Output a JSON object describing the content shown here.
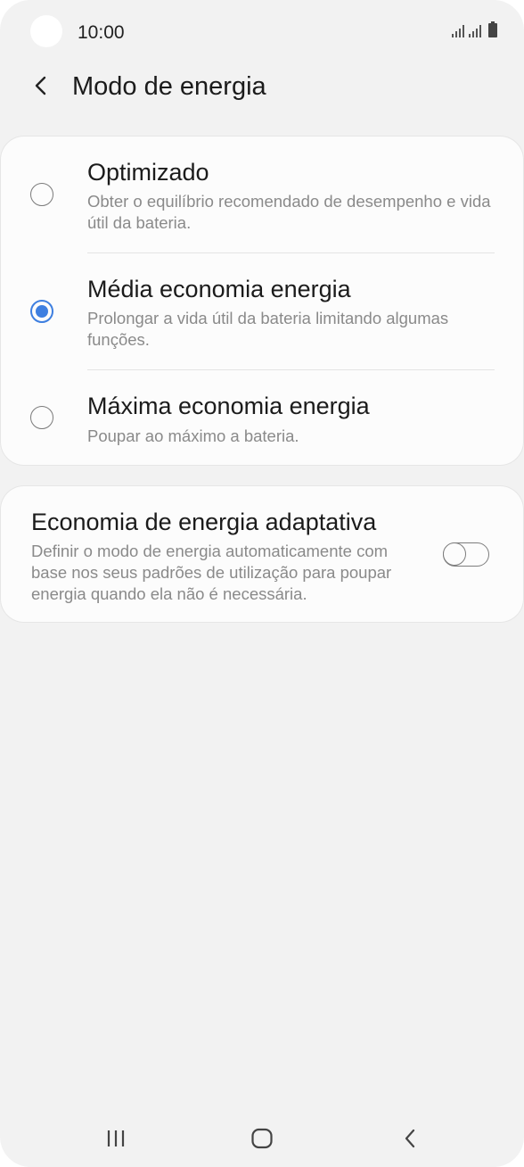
{
  "status_bar": {
    "time": "10:00",
    "icons": [
      "signal-icon",
      "signal-icon",
      "battery-icon"
    ]
  },
  "header": {
    "back_icon": "chevron-left-icon",
    "title": "Modo de energia"
  },
  "power_modes": {
    "selected_index": 1,
    "options": [
      {
        "title": "Optimizado",
        "description": "Obter o equilíbrio recomendado de desempenho e vida útil da bateria.",
        "selected": false
      },
      {
        "title": "Média economia energia",
        "description": "Prolongar a vida útil da bateria limitando algumas funções.",
        "selected": true
      },
      {
        "title": "Máxima economia energia",
        "description": "Poupar ao máximo a bateria.",
        "selected": false
      }
    ]
  },
  "adaptive": {
    "title": "Economia de energia adaptativa",
    "description": "Definir o modo de energia automaticamente com base nos seus padrões de utilização para poupar energia quando ela não é necessária.",
    "enabled": false
  },
  "nav_bar": {
    "recents_icon": "recents-icon",
    "home_icon": "home-icon",
    "back_icon": "back-icon"
  },
  "colors": {
    "accent": "#3e7fe0",
    "background": "#f2f2f2",
    "card": "#fcfcfc"
  }
}
